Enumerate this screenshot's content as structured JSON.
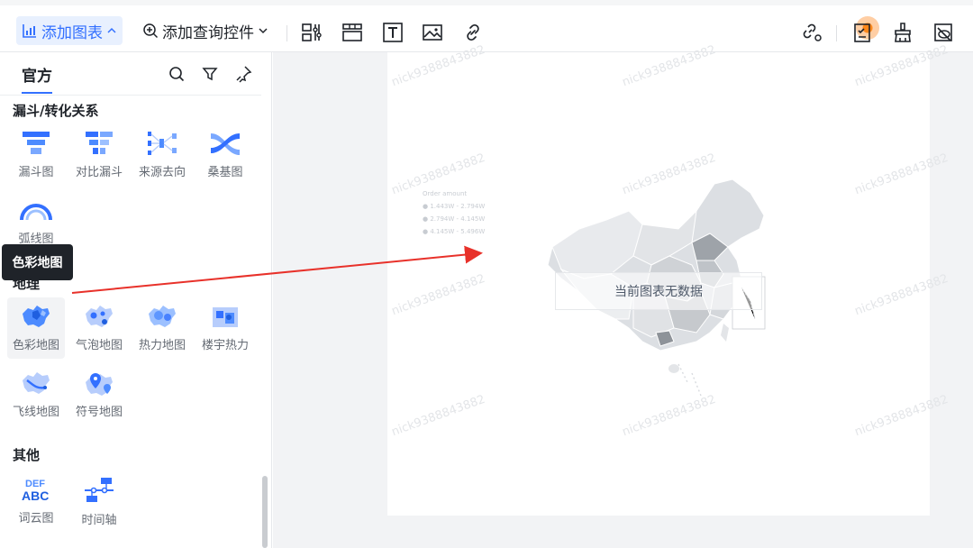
{
  "toolbar": {
    "add_chart_label": "添加图表",
    "add_query_label": "添加查询控件"
  },
  "sidebar": {
    "tab_label": "官方",
    "sections": [
      {
        "title": "漏斗/转化关系",
        "items": [
          {
            "label": "漏斗图",
            "icon": "funnel-chart-icon"
          },
          {
            "label": "对比漏斗",
            "icon": "compare-funnel-icon"
          },
          {
            "label": "来源去向",
            "icon": "source-destination-icon"
          },
          {
            "label": "桑基图",
            "icon": "sankey-icon"
          },
          {
            "label": "弧线图",
            "icon": "arc-chart-icon"
          }
        ]
      },
      {
        "title": "地理",
        "items": [
          {
            "label": "色彩地图",
            "icon": "color-map-icon"
          },
          {
            "label": "气泡地图",
            "icon": "bubble-map-icon"
          },
          {
            "label": "热力地图",
            "icon": "heat-map-icon"
          },
          {
            "label": "楼宇热力",
            "icon": "building-heat-icon"
          },
          {
            "label": "飞线地图",
            "icon": "flight-line-map-icon"
          },
          {
            "label": "符号地图",
            "icon": "symbol-map-icon"
          }
        ]
      },
      {
        "title": "其他",
        "items": [
          {
            "label": "词云图",
            "icon": "word-cloud-icon"
          },
          {
            "label": "时间轴",
            "icon": "timeline-icon"
          }
        ]
      }
    ]
  },
  "tooltip": {
    "text": "色彩地图"
  },
  "canvas": {
    "nodata_text": "当前图表无数据",
    "watermark": "nick9388843882",
    "legend_title": "Order amount",
    "legend_items": [
      "1.443W - 2.794W",
      "2.794W - 4.145W",
      "4.145W - 5.496W"
    ]
  },
  "colors": {
    "accent": "#3370ff",
    "arrow": "#e8312a"
  }
}
